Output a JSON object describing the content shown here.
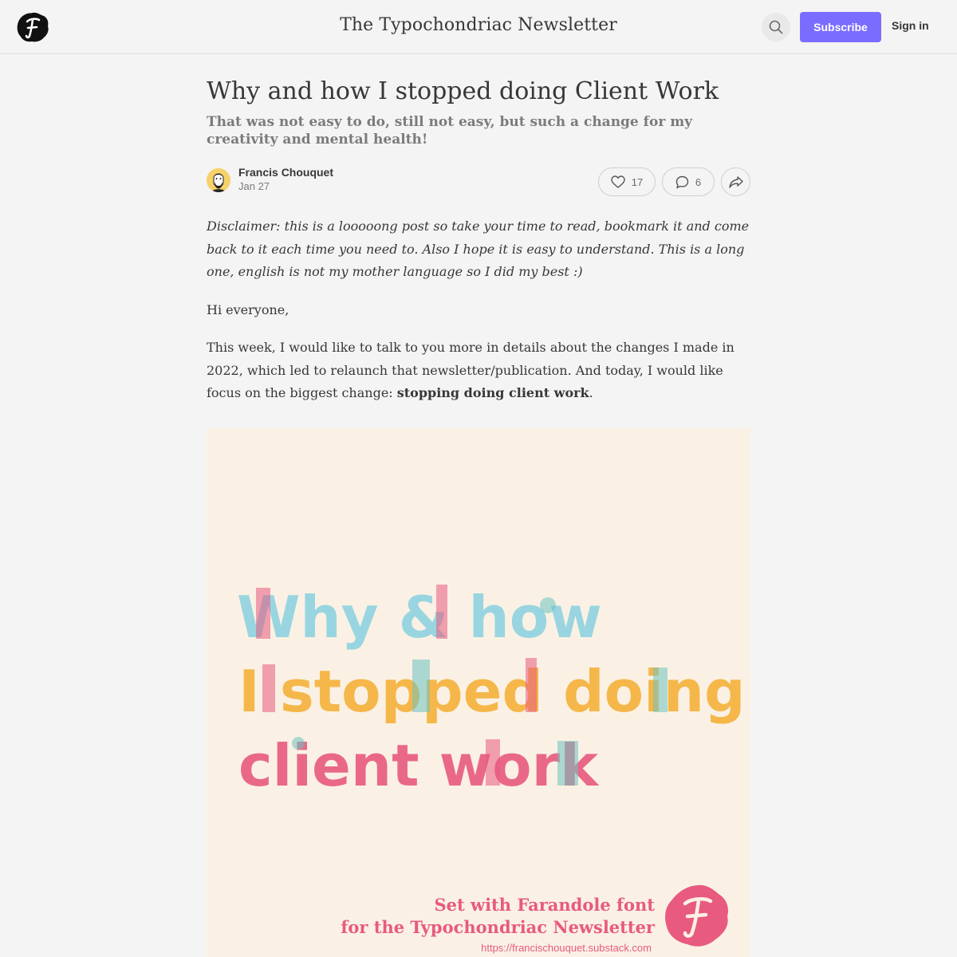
{
  "header": {
    "publication_title": "The Typochondriac Newsletter",
    "subscribe_label": "Subscribe",
    "signin_label": "Sign in",
    "logo_icon": "publication-logo-icon",
    "search_icon": "search-icon"
  },
  "post": {
    "title": "Why and how I stopped doing Client Work",
    "subtitle": "That was not easy to do, still not easy, but such a change for my creativity and mental health!",
    "author": "Francis Chouquet",
    "date": "Jan 27",
    "likes": "17",
    "comments": "6",
    "body": {
      "disclaimer": "Disclaimer: this is a looooong post so take your time to read, bookmark it and come back to it each time you need to. Also I hope it is easy to understand. This is a long one, english is not my mother language so I did my best :)",
      "greeting": "Hi everyone,",
      "para_intro": "This week, I would like to talk to you more in details about the changes I made in 2022, which led to relaunch that newsletter/publication. And today, I would like focus on the biggest change: ",
      "para_bold": "stopping doing client work",
      "para_end": "."
    }
  },
  "hero_image": {
    "line1": "Why & how",
    "line2": "I stopped doing",
    "line3": "client work",
    "credit_line1": "Set with Farandole font",
    "credit_line2": "for the Typochondriac Newsletter",
    "credit_url": "https://francischouquet.substack.com",
    "background": "#faf1e4",
    "colors": [
      "#e85a7f",
      "#f5b13a",
      "#6ec3c0",
      "#8fd3e0"
    ]
  },
  "colors": {
    "accent": "#7a6cfe",
    "text": "#363737",
    "muted": "#7b7b7b"
  }
}
